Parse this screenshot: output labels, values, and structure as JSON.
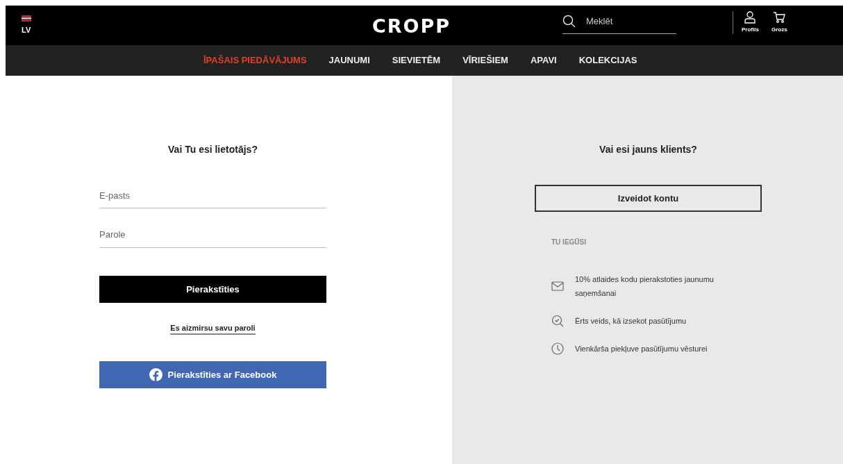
{
  "header": {
    "language": "LV",
    "logo": "CROPP",
    "search": {
      "placeholder": "Meklēt"
    },
    "actions": [
      {
        "kind": "profile",
        "label": "Profils"
      },
      {
        "kind": "cart",
        "label": "Grozs"
      }
    ]
  },
  "nav": [
    {
      "label": "ĪPAŠAIS PIEDĀVĀJUMS",
      "highlight": true
    },
    {
      "label": "JAUNUMI",
      "highlight": false
    },
    {
      "label": "SIEVIETĒM",
      "highlight": false
    },
    {
      "label": "VĪRIEŠIEM",
      "highlight": false
    },
    {
      "label": "APAVI",
      "highlight": false
    },
    {
      "label": "KOLEKCIJAS",
      "highlight": false
    }
  ],
  "login": {
    "title": "Vai Tu esi lietotājs?",
    "fields": [
      {
        "placeholder": "E-pasts"
      },
      {
        "placeholder": "Parole"
      }
    ],
    "submit": "Pierakstīties",
    "forgot": "Es aizmirsu savu paroli",
    "facebook": "Pierakstīties ar Facebook"
  },
  "register": {
    "title": "Vai esi jauns klients?",
    "button": "Izveidot kontu",
    "benefits_heading": "TU IEGŪSI",
    "benefits": [
      {
        "kind": "mail",
        "text": "10% atlaides kodu pierakstoties jaunumu saņemšanai"
      },
      {
        "kind": "track",
        "text": "Ērts veids, kā izsekot pasūtījumu"
      },
      {
        "kind": "history",
        "text": "Vienkārša piekļuve pasūtījumu vēsturei"
      }
    ]
  }
}
